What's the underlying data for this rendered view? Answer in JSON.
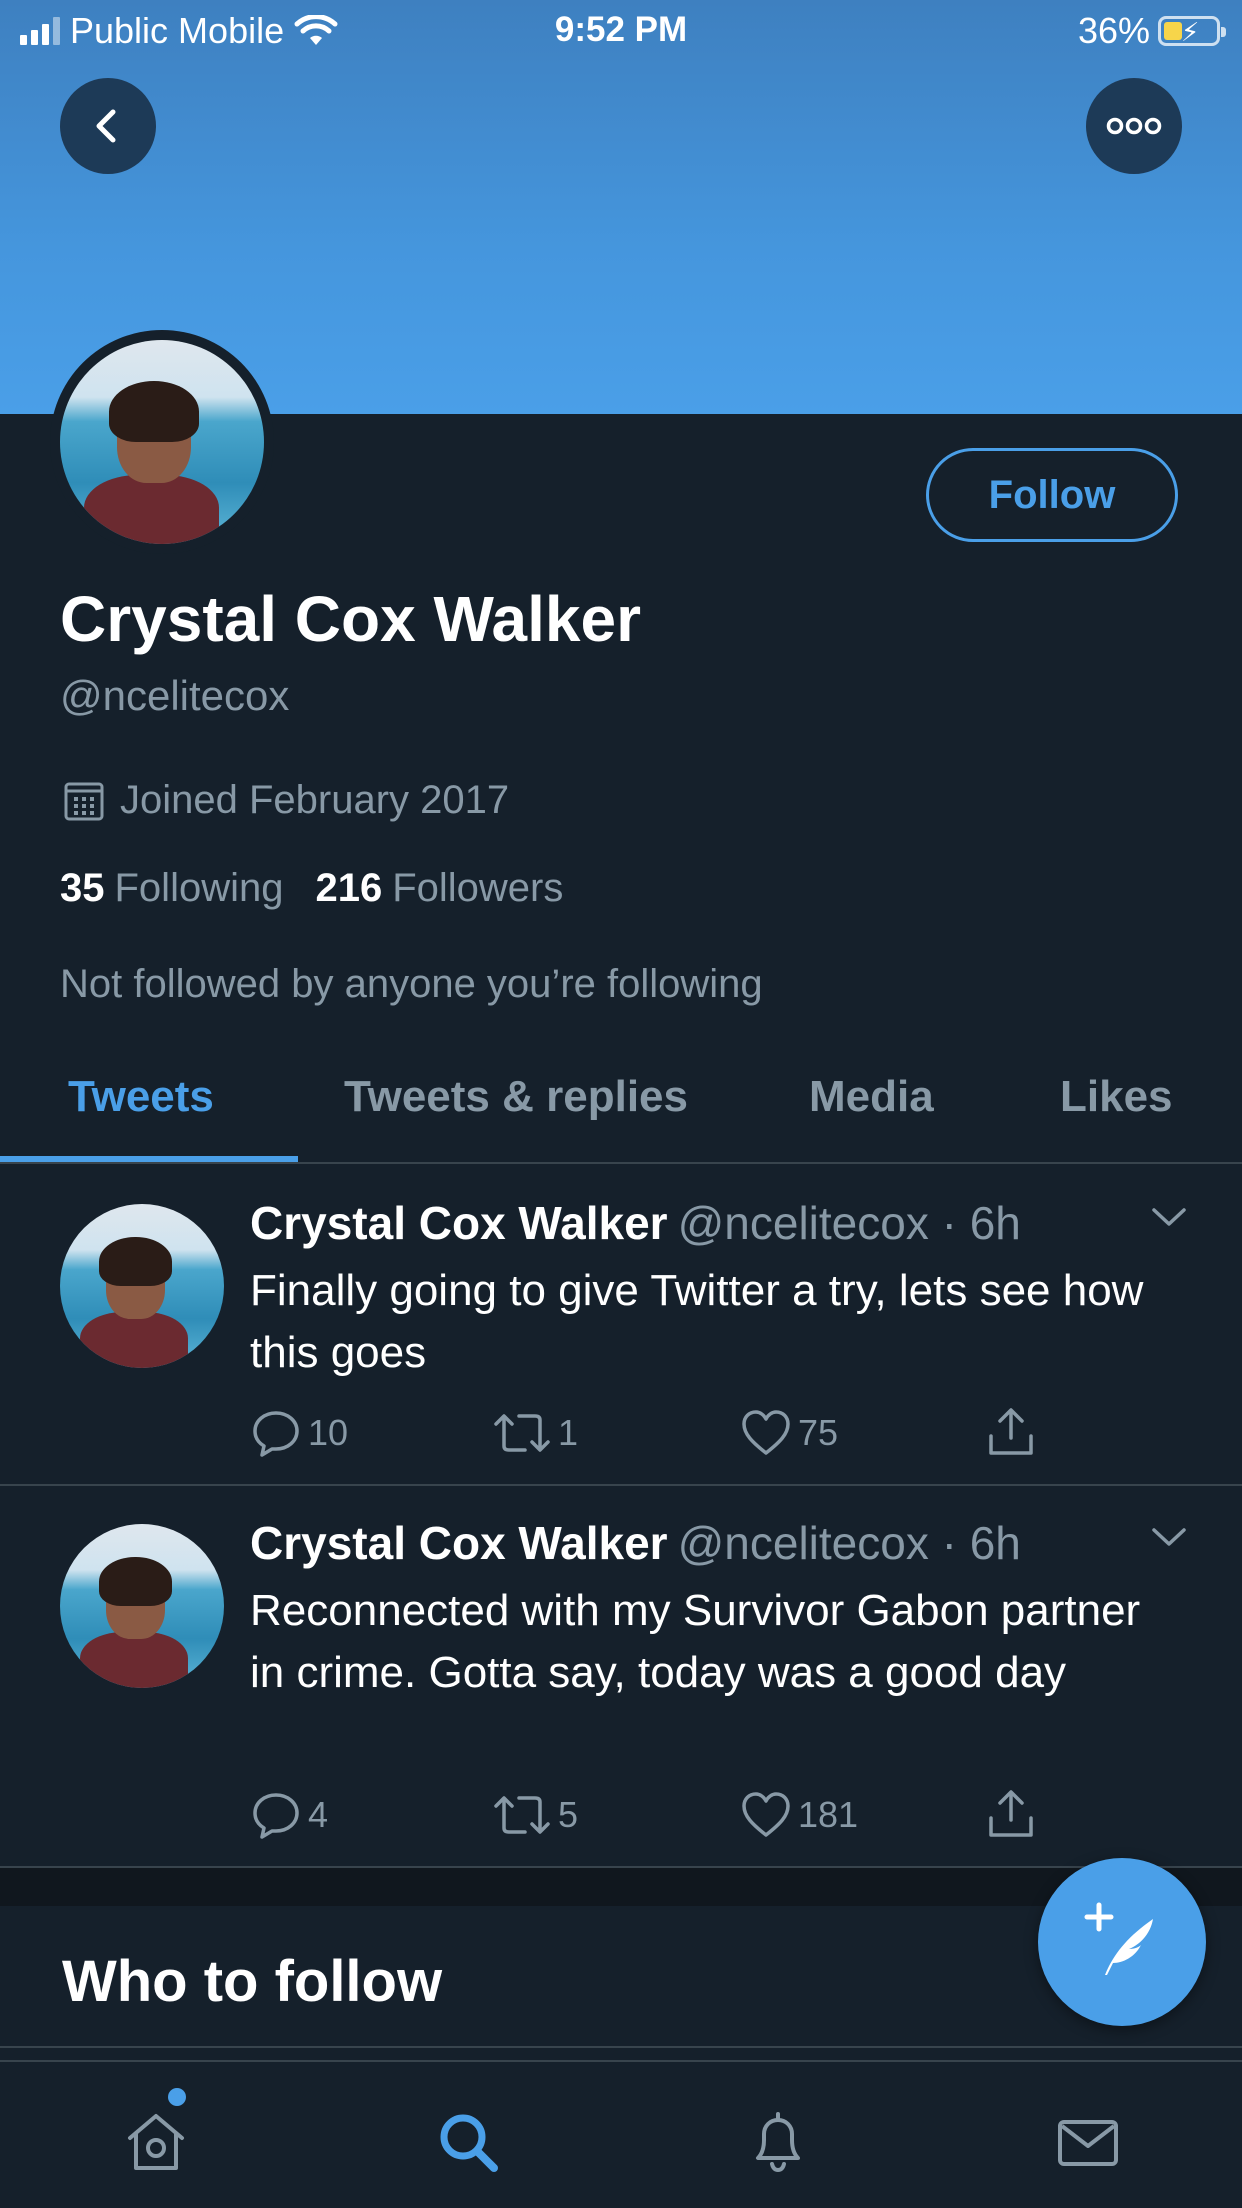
{
  "status_bar": {
    "carrier": "Public Mobile",
    "time": "9:52 PM",
    "battery_percent": "36%",
    "battery_level": 0.36
  },
  "profile": {
    "display_name": "Crystal Cox Walker",
    "handle": "@ncelitecox",
    "joined": "Joined February 2017",
    "following_count": "35",
    "following_label": "Following",
    "followers_count": "216",
    "followers_label": "Followers",
    "followed_by_note": "Not followed by anyone you’re following",
    "follow_button_label": "Follow"
  },
  "tabs": [
    {
      "label": "Tweets",
      "active": true
    },
    {
      "label": "Tweets & replies",
      "active": false
    },
    {
      "label": "Media",
      "active": false
    },
    {
      "label": "Likes",
      "active": false
    }
  ],
  "tweets": [
    {
      "name": "Crystal Cox Walker",
      "meta": "@ncelitecox · 6h",
      "text": "Finally going to give Twitter a try, lets see how this goes",
      "replies": "10",
      "retweets": "1",
      "likes": "75"
    },
    {
      "name": "Crystal Cox Walker",
      "meta": "@ncelitecox · 6h",
      "text": "Reconnected with my Survivor Gabon partner in crime. Gotta say, today was a good day",
      "replies": "4",
      "retweets": "5",
      "likes": "181"
    }
  ],
  "who_to_follow": {
    "title": "Who to follow"
  },
  "bottom_nav": [
    {
      "icon": "home-icon"
    },
    {
      "icon": "search-icon",
      "active": true
    },
    {
      "icon": "bell-icon"
    },
    {
      "icon": "mail-icon"
    }
  ],
  "colors": {
    "background": "#15202b",
    "accent": "#4a9fe8",
    "muted_text": "#8899a6",
    "divider": "#38444d"
  }
}
